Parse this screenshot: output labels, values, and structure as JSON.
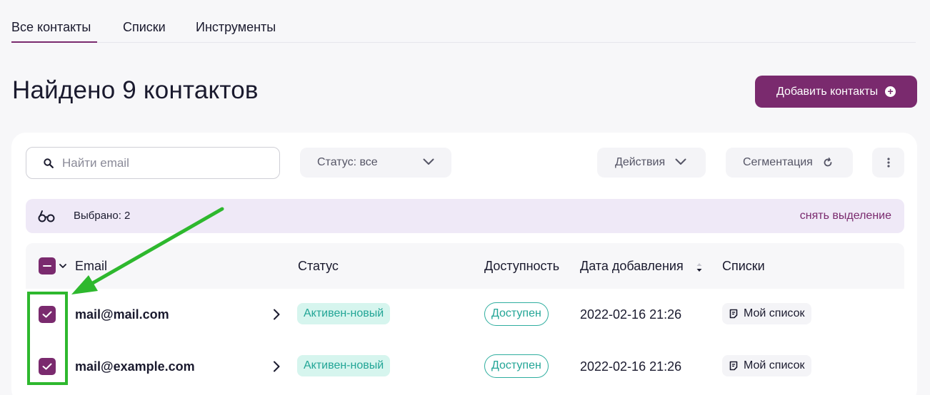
{
  "tabs": [
    {
      "label": "Все контакты",
      "active": true
    },
    {
      "label": "Списки"
    },
    {
      "label": "Инструменты"
    }
  ],
  "page_title": "Найдено 9 контактов",
  "add_button": {
    "label": "Добавить контакты",
    "icon": "plus-circle-icon"
  },
  "search": {
    "placeholder": "Найти email",
    "value": "",
    "icon": "search-icon"
  },
  "filters": {
    "status_label": "Статус: все",
    "actions_label": "Действия",
    "segmentation_label": "Сегментация"
  },
  "selection": {
    "count_label": "Выбрано: 2",
    "clear_label": "снять выделение",
    "icon": "glasses-icon"
  },
  "table": {
    "headers": {
      "email": "Email",
      "status": "Статус",
      "availability": "Доступность",
      "date_added": "Дата добавления",
      "lists": "Списки"
    },
    "rows": [
      {
        "email": "mail@mail.com",
        "status": "Активен-новый",
        "availability": "Доступен",
        "date": "2022-02-16 21:26",
        "list": "Мой список",
        "checked": true
      },
      {
        "email": "mail@example.com",
        "status": "Активен-новый",
        "availability": "Доступен",
        "date": "2022-02-16 21:26",
        "list": "Мой список",
        "checked": true
      }
    ]
  },
  "colors": {
    "accent": "#7a2a6e",
    "status_green": "#22a596",
    "selection_bg": "#efe9f7",
    "annotation_green": "#2eb82e"
  }
}
